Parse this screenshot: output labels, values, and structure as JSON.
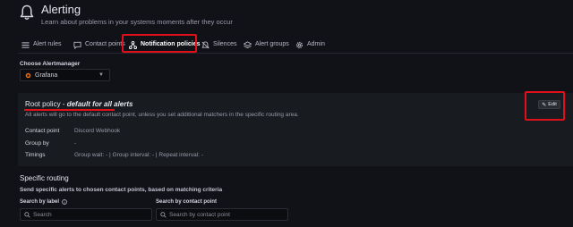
{
  "header": {
    "title": "Alerting",
    "subtitle": "Learn about problems in your systems moments after they occur",
    "icon": "bell-icon"
  },
  "tabs": [
    {
      "label": "Alert rules",
      "icon": "list-icon"
    },
    {
      "label": "Contact points",
      "icon": "comment-icon"
    },
    {
      "label": "Notification policies",
      "icon": "sitemap-icon",
      "active": true
    },
    {
      "label": "Silences",
      "icon": "bell-slash-icon"
    },
    {
      "label": "Alert groups",
      "icon": "layer-group-icon"
    },
    {
      "label": "Admin",
      "icon": "cog-icon"
    }
  ],
  "alertmanager": {
    "label": "Choose Alertmanager",
    "selected": "Grafana"
  },
  "root_policy": {
    "title_prefix": "Root policy - ",
    "title_emphasis": "default for all alerts",
    "description": "All alerts will go to the default contact point, unless you set additional matchers in the specific routing area.",
    "edit_label": "Edit",
    "fields": [
      {
        "key": "Contact point",
        "value": "Discord Webhook"
      },
      {
        "key": "Group by",
        "value": "-"
      },
      {
        "key": "Timings",
        "value": "Group wait: - | Group interval: - | Repeat interval: -"
      }
    ]
  },
  "specific_routing": {
    "title": "Specific routing",
    "description": "Send specific alerts to chosen contact points, based on matching criteria",
    "search_by_label": {
      "label": "Search by label",
      "placeholder": "Search"
    },
    "search_by_contact": {
      "label": "Search by contact point",
      "placeholder": "Search by contact point"
    }
  },
  "colors": {
    "background": "#111217",
    "panel": "#181b1f",
    "highlight": "#e0101a",
    "tab_accent": "#ff7a1a"
  }
}
